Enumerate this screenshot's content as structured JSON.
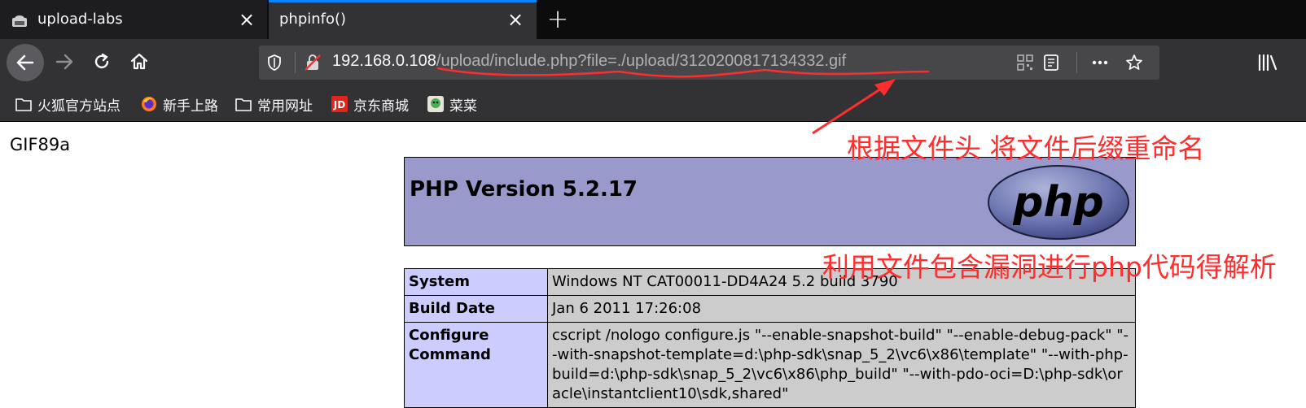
{
  "tabs": [
    {
      "title": "upload-labs",
      "active": false
    },
    {
      "title": "phpinfo()",
      "active": true
    }
  ],
  "url": {
    "host": "192.168.0.108",
    "path": "/upload/include.php?file=./upload/3120200817134332.gif"
  },
  "bookmarks": [
    {
      "label": "火狐官方站点",
      "icon": "folder-icon"
    },
    {
      "label": "新手上路",
      "icon": "firefox-icon"
    },
    {
      "label": "常用网址",
      "icon": "folder-icon"
    },
    {
      "label": "京东商城",
      "icon": "jd-icon"
    },
    {
      "label": "菜菜",
      "icon": "site-icon"
    }
  ],
  "page": {
    "gif_header": "GIF89a",
    "php_version": "PHP Version 5.2.17",
    "rows": [
      {
        "key": "System",
        "value": "Windows NT CAT00011-DD4A24 5.2 build 3790"
      },
      {
        "key": "Build Date",
        "value": "Jan 6 2011 17:26:08"
      },
      {
        "key": "Configure Command",
        "value": "cscript /nologo configure.js \"--enable-snapshot-build\" \"--enable-debug-pack\" \"--with-snapshot-template=d:\\php-sdk\\snap_5_2\\vc6\\x86\\template\" \"--with-php-build=d:\\php-sdk\\snap_5_2\\vc6\\x86\\php_build\" \"--with-pdo-oci=D:\\php-sdk\\oracle\\instantclient10\\sdk,shared\""
      }
    ]
  },
  "annotations": {
    "note1": "根据文件头 将文件后缀重命名",
    "note2": "利用文件包含漏洞进行php代码得解析",
    "color": "#ff2d2d"
  },
  "colors": {
    "accent": "#0a84ff",
    "php_header": "#9999cc",
    "php_key": "#ccccff",
    "php_value": "#cccccc"
  }
}
